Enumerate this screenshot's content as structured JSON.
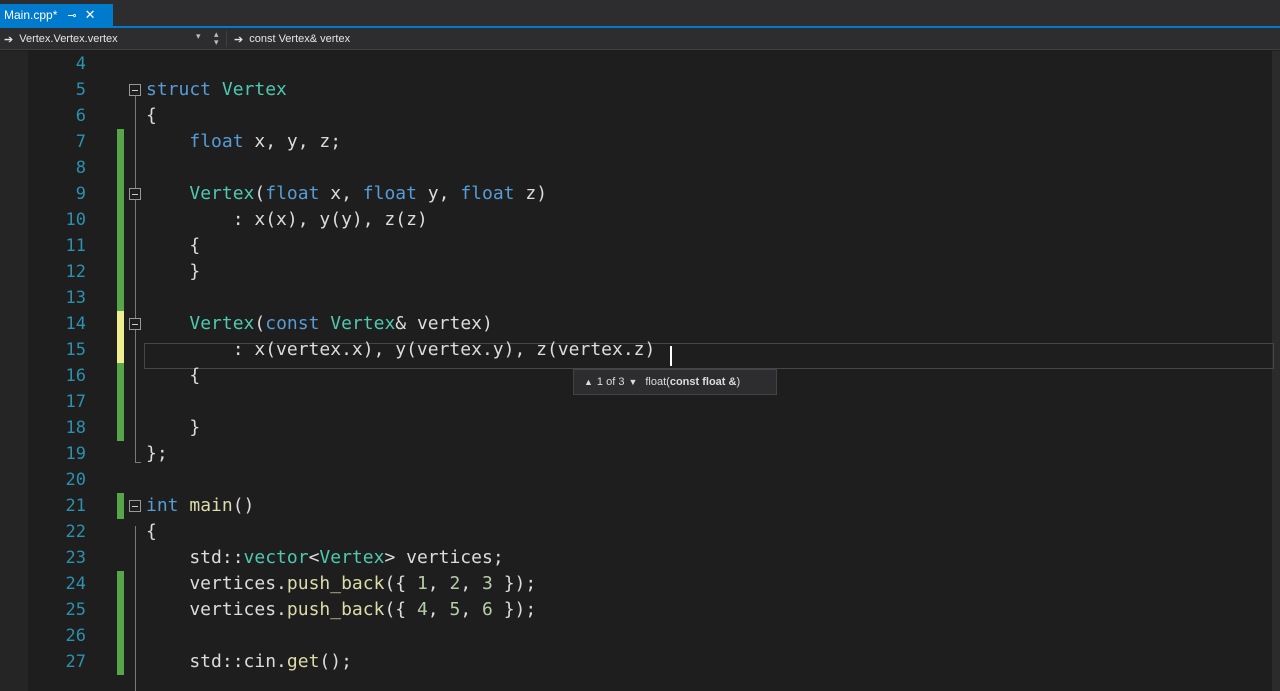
{
  "tab": {
    "title": "Main.cpp*",
    "pin_icon": "pin-icon",
    "close_icon": "close-icon"
  },
  "navbar": {
    "scope": "Vertex.Vertex.vertex",
    "member": "const Vertex& vertex"
  },
  "accent_color": "#007acc",
  "editor": {
    "lines": [
      {
        "num": "4",
        "code": ""
      },
      {
        "num": "5",
        "code": "struct Vertex"
      },
      {
        "num": "6",
        "code": "{"
      },
      {
        "num": "7",
        "code": "    float x, y, z;"
      },
      {
        "num": "8",
        "code": ""
      },
      {
        "num": "9",
        "code": "    Vertex(float x, float y, float z)"
      },
      {
        "num": "10",
        "code": "        : x(x), y(y), z(z)"
      },
      {
        "num": "11",
        "code": "    {"
      },
      {
        "num": "12",
        "code": "    }"
      },
      {
        "num": "13",
        "code": ""
      },
      {
        "num": "14",
        "code": "    Vertex(const Vertex& vertex)"
      },
      {
        "num": "15",
        "code": "        : x(vertex.x), y(vertex.y), z(vertex.z)"
      },
      {
        "num": "16",
        "code": "    {"
      },
      {
        "num": "17",
        "code": ""
      },
      {
        "num": "18",
        "code": "    }"
      },
      {
        "num": "19",
        "code": "};"
      },
      {
        "num": "20",
        "code": ""
      },
      {
        "num": "21",
        "code": "int main()"
      },
      {
        "num": "22",
        "code": "{"
      },
      {
        "num": "23",
        "code": "    std::vector<Vertex> vertices;"
      },
      {
        "num": "24",
        "code": "    vertices.push_back({ 1, 2, 3 });"
      },
      {
        "num": "25",
        "code": "    vertices.push_back({ 4, 5, 6 });"
      },
      {
        "num": "26",
        "code": ""
      },
      {
        "num": "27",
        "code": "    std::cin.get();"
      }
    ]
  },
  "signature_help": {
    "count": "1 of 3",
    "signature_prefix": "float(",
    "signature_param": "const float &",
    "signature_suffix": ")"
  }
}
